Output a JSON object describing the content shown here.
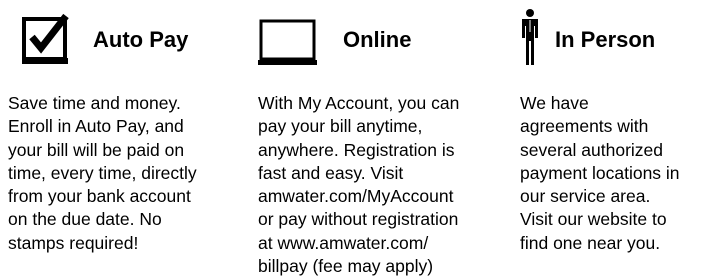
{
  "autopay": {
    "icon": "checked-box-icon",
    "title": "Auto Pay",
    "body": "Save time and money.\nEnroll in Auto Pay, and\nyour bill will be paid on\ntime, every time, directly\nfrom your bank account\non the due date. No\nstamps required!"
  },
  "online": {
    "icon": "computer-screen-icon",
    "title": "Online",
    "body": "With My Account, you can\npay your bill anytime,\nanywhere. Registration is\nfast and easy. Visit\namwater.com/MyAccount\nor pay without registration\nat www.amwater.com/\nbillpay (fee may apply)"
  },
  "inperson": {
    "icon": "person-icon",
    "title": "In Person",
    "body": "We have\nagreements with\nseveral authorized\npayment locations in\nour service area.\nVisit our website to\nfind one near you."
  }
}
